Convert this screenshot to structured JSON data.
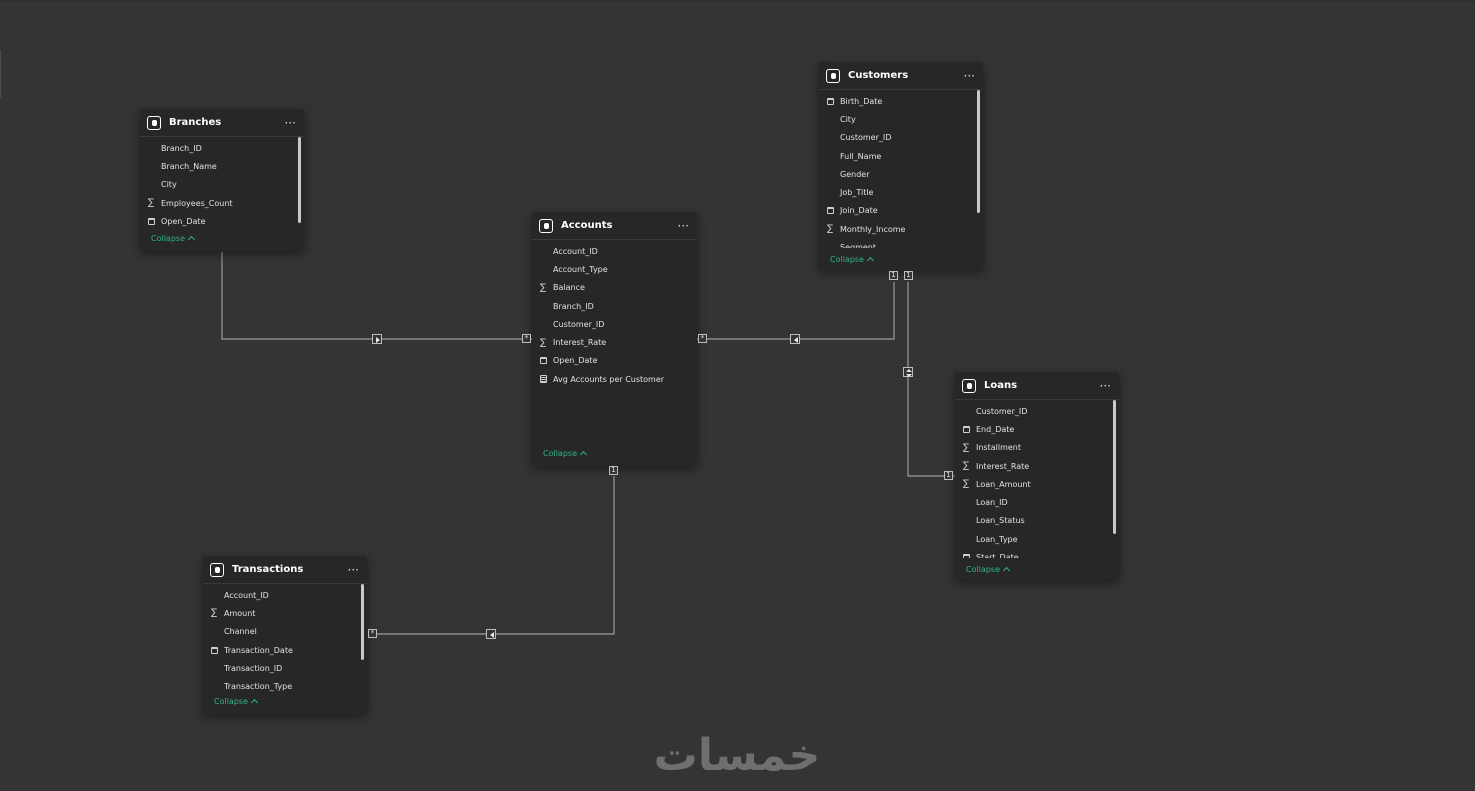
{
  "tables": {
    "branches": {
      "title": "Branches",
      "fields": [
        {
          "name": "Branch_ID",
          "icon": ""
        },
        {
          "name": "Branch_Name",
          "icon": ""
        },
        {
          "name": "City",
          "icon": ""
        },
        {
          "name": "Employees_Count",
          "icon": "sigma"
        },
        {
          "name": "Open_Date",
          "icon": "calendar"
        }
      ],
      "collapse": "Collapse"
    },
    "accounts": {
      "title": "Accounts",
      "fields": [
        {
          "name": "Account_ID",
          "icon": ""
        },
        {
          "name": "Account_Type",
          "icon": ""
        },
        {
          "name": "Balance",
          "icon": "sigma"
        },
        {
          "name": "Branch_ID",
          "icon": ""
        },
        {
          "name": "Customer_ID",
          "icon": ""
        },
        {
          "name": "Interest_Rate",
          "icon": "sigma"
        },
        {
          "name": "Open_Date",
          "icon": "calendar"
        },
        {
          "name": "Avg Accounts per Customer",
          "icon": "calculator"
        }
      ],
      "collapse": "Collapse"
    },
    "customers": {
      "title": "Customers",
      "fields": [
        {
          "name": "Birth_Date",
          "icon": "calendar"
        },
        {
          "name": "City",
          "icon": ""
        },
        {
          "name": "Customer_ID",
          "icon": ""
        },
        {
          "name": "Full_Name",
          "icon": ""
        },
        {
          "name": "Gender",
          "icon": ""
        },
        {
          "name": "Job_Title",
          "icon": ""
        },
        {
          "name": "Join_Date",
          "icon": "calendar"
        },
        {
          "name": "Monthly_Income",
          "icon": "sigma"
        },
        {
          "name": "Segment",
          "icon": ""
        }
      ],
      "collapse": "Collapse"
    },
    "loans": {
      "title": "Loans",
      "fields": [
        {
          "name": "Customer_ID",
          "icon": ""
        },
        {
          "name": "End_Date",
          "icon": "calendar"
        },
        {
          "name": "Installment",
          "icon": "sigma"
        },
        {
          "name": "Interest_Rate",
          "icon": "sigma"
        },
        {
          "name": "Loan_Amount",
          "icon": "sigma"
        },
        {
          "name": "Loan_ID",
          "icon": ""
        },
        {
          "name": "Loan_Status",
          "icon": ""
        },
        {
          "name": "Loan_Type",
          "icon": ""
        },
        {
          "name": "Start_Date",
          "icon": "calendar"
        }
      ],
      "collapse": "Collapse"
    },
    "transactions": {
      "title": "Transactions",
      "fields": [
        {
          "name": "Account_ID",
          "icon": ""
        },
        {
          "name": "Amount",
          "icon": "sigma"
        },
        {
          "name": "Channel",
          "icon": ""
        },
        {
          "name": "Transaction_Date",
          "icon": "calendar"
        },
        {
          "name": "Transaction_ID",
          "icon": ""
        },
        {
          "name": "Transaction_Type",
          "icon": ""
        }
      ],
      "collapse": "Collapse"
    }
  },
  "relationships": [
    {
      "from": "Branches",
      "to": "Accounts",
      "from_cardinality": "",
      "to_cardinality": "*",
      "filter_direction": "single"
    },
    {
      "from": "Customers",
      "to": "Accounts",
      "from_cardinality": "1",
      "to_cardinality": "*",
      "filter_direction": "single"
    },
    {
      "from": "Customers",
      "to": "Loans",
      "from_cardinality": "1",
      "to_cardinality": "1",
      "filter_direction": "both"
    },
    {
      "from": "Accounts",
      "to": "Transactions",
      "from_cardinality": "1",
      "to_cardinality": "*",
      "filter_direction": "single"
    }
  ],
  "watermark": {
    "text": "خمسات"
  },
  "colors": {
    "background": "#343434",
    "card": "#272727",
    "accent": "#2fb58e",
    "line": "#9a9a9a"
  }
}
